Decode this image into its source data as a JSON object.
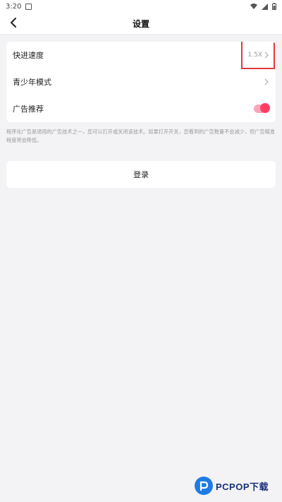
{
  "status_bar": {
    "time": "3:20"
  },
  "header": {
    "title": "设置"
  },
  "settings": {
    "fast_forward": {
      "label": "快进速度",
      "value": "1.5X"
    },
    "youth_mode": {
      "label": "青少年模式"
    },
    "ad_recommend": {
      "label": "广告推荐",
      "enabled": true
    }
  },
  "note": "程序化广告是通用的广告技术之一，您可以打开或关闭该技术。如果打开开关，您看到的广告数量不会减少，但广告精准程度将会降低。",
  "login": {
    "label": "登录"
  },
  "watermark": {
    "text": "PCPOP下载"
  },
  "colors": {
    "accent": "#ff3d63",
    "highlight": "#e03a3a",
    "brand": "#1e7be6"
  }
}
